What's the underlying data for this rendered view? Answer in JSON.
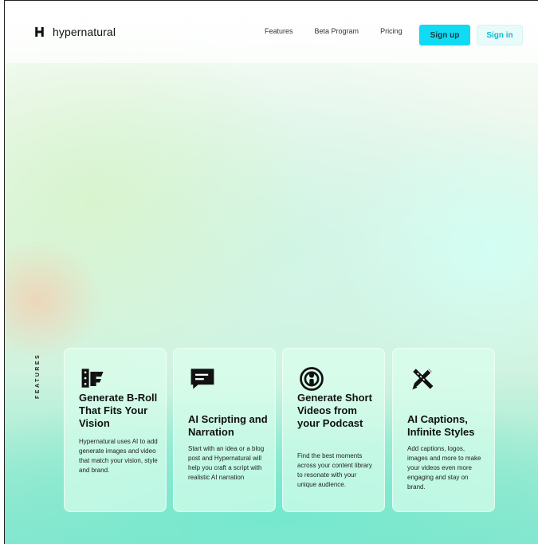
{
  "header": {
    "brand": {
      "name": "hypernatural",
      "icon": "hypernatural-logo-icon"
    },
    "nav": [
      {
        "label": "Features"
      },
      {
        "label": "Beta Program"
      },
      {
        "label": "Pricing"
      }
    ],
    "buttons": {
      "signup": "Sign up",
      "signin": "Sign in"
    }
  },
  "features": {
    "section_label": "FEATURES",
    "cards": [
      {
        "icon": "film-reel-icon",
        "title": "Generate B-Roll That Fits Your Vision",
        "description": "Hypernatural uses AI to add generate images and video that match your vision, style and brand."
      },
      {
        "icon": "speech-bubble-icon",
        "title": "AI Scripting and Narration",
        "description": "Start with an idea or a blog post and Hypernatural will help you craft a script with realistic AI narration"
      },
      {
        "icon": "podcast-icon",
        "title": "Generate Short Videos from your Podcast",
        "description": "Find the best moments across your content library to resonate with your unique audience."
      },
      {
        "icon": "design-tools-icon",
        "title": "AI Captions, Infinite Styles",
        "description": "Add captions, logos, images and more to make your videos even more engaging and stay on brand."
      }
    ]
  },
  "colors": {
    "signup_bg": "#10dbf2",
    "signin_text": "#12b7ca",
    "signin_bg": "#e8fbfb",
    "hero_top": "#fbfdfc",
    "hero_bottom": "#88e6cf"
  }
}
